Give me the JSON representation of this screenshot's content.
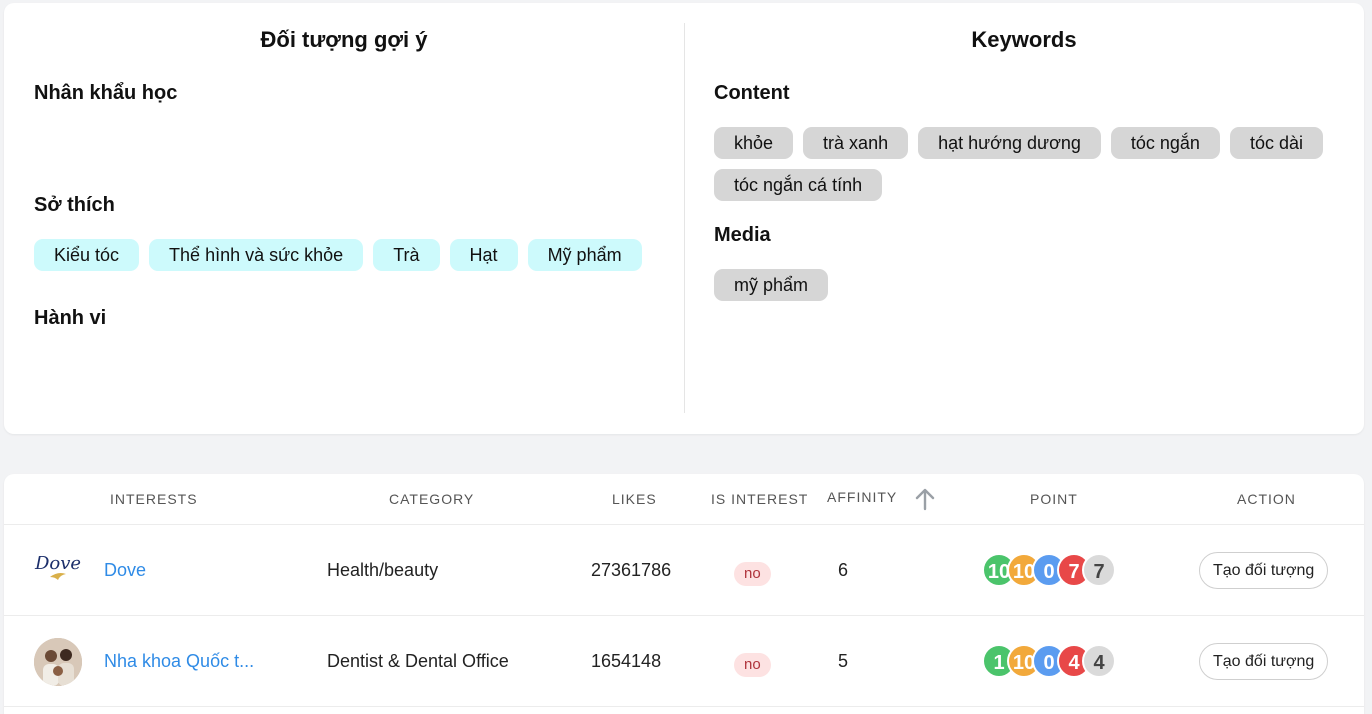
{
  "left_panel": {
    "title": "Đối tượng gợi ý",
    "demographics_title": "Nhân khẩu học",
    "interests_title": "Sở thích",
    "interests": [
      "Kiểu tóc",
      "Thể hình và sức khỏe",
      "Trà",
      "Hạt",
      "Mỹ phẩm"
    ],
    "behavior_title": "Hành vi"
  },
  "right_panel": {
    "title": "Keywords",
    "content_title": "Content",
    "content_keywords": [
      "khỏe",
      "trà xanh",
      "hạt hướng dương",
      "tóc ngắn",
      "tóc dài",
      "tóc ngắn cá tính"
    ],
    "media_title": "Media",
    "media_keywords": [
      "mỹ phẩm"
    ]
  },
  "table": {
    "headers": {
      "interests": "INTERESTS",
      "category": "CATEGORY",
      "likes": "LIKES",
      "is_interest": "IS INTEREST",
      "affinity": "AFFINITY",
      "point": "POINT",
      "action": "ACTION"
    },
    "sort_icon": "arrow-up-icon",
    "rows": [
      {
        "logo": "dove-logo",
        "logo_text": "Dove",
        "name": "Dove",
        "category": "Health/beauty",
        "likes": "27361786",
        "is_interest": "no",
        "affinity": "6",
        "points": [
          "10",
          "10",
          "0",
          "7",
          "7"
        ],
        "action": "Tạo đối tượng"
      },
      {
        "logo": "dental-clinic-avatar",
        "name": "Nha khoa Quốc t...",
        "category": "Dentist & Dental Office",
        "likes": "1654148",
        "is_interest": "no",
        "affinity": "5",
        "points": [
          "1",
          "10",
          "0",
          "4",
          "4"
        ],
        "action": "Tạo đối tượng"
      }
    ]
  },
  "colors": {
    "point_green": "#4bc46b",
    "point_orange": "#f2a93b",
    "point_blue": "#5b9cf0",
    "point_red": "#e84848",
    "point_gray": "#dadada",
    "link": "#2f8be6"
  }
}
